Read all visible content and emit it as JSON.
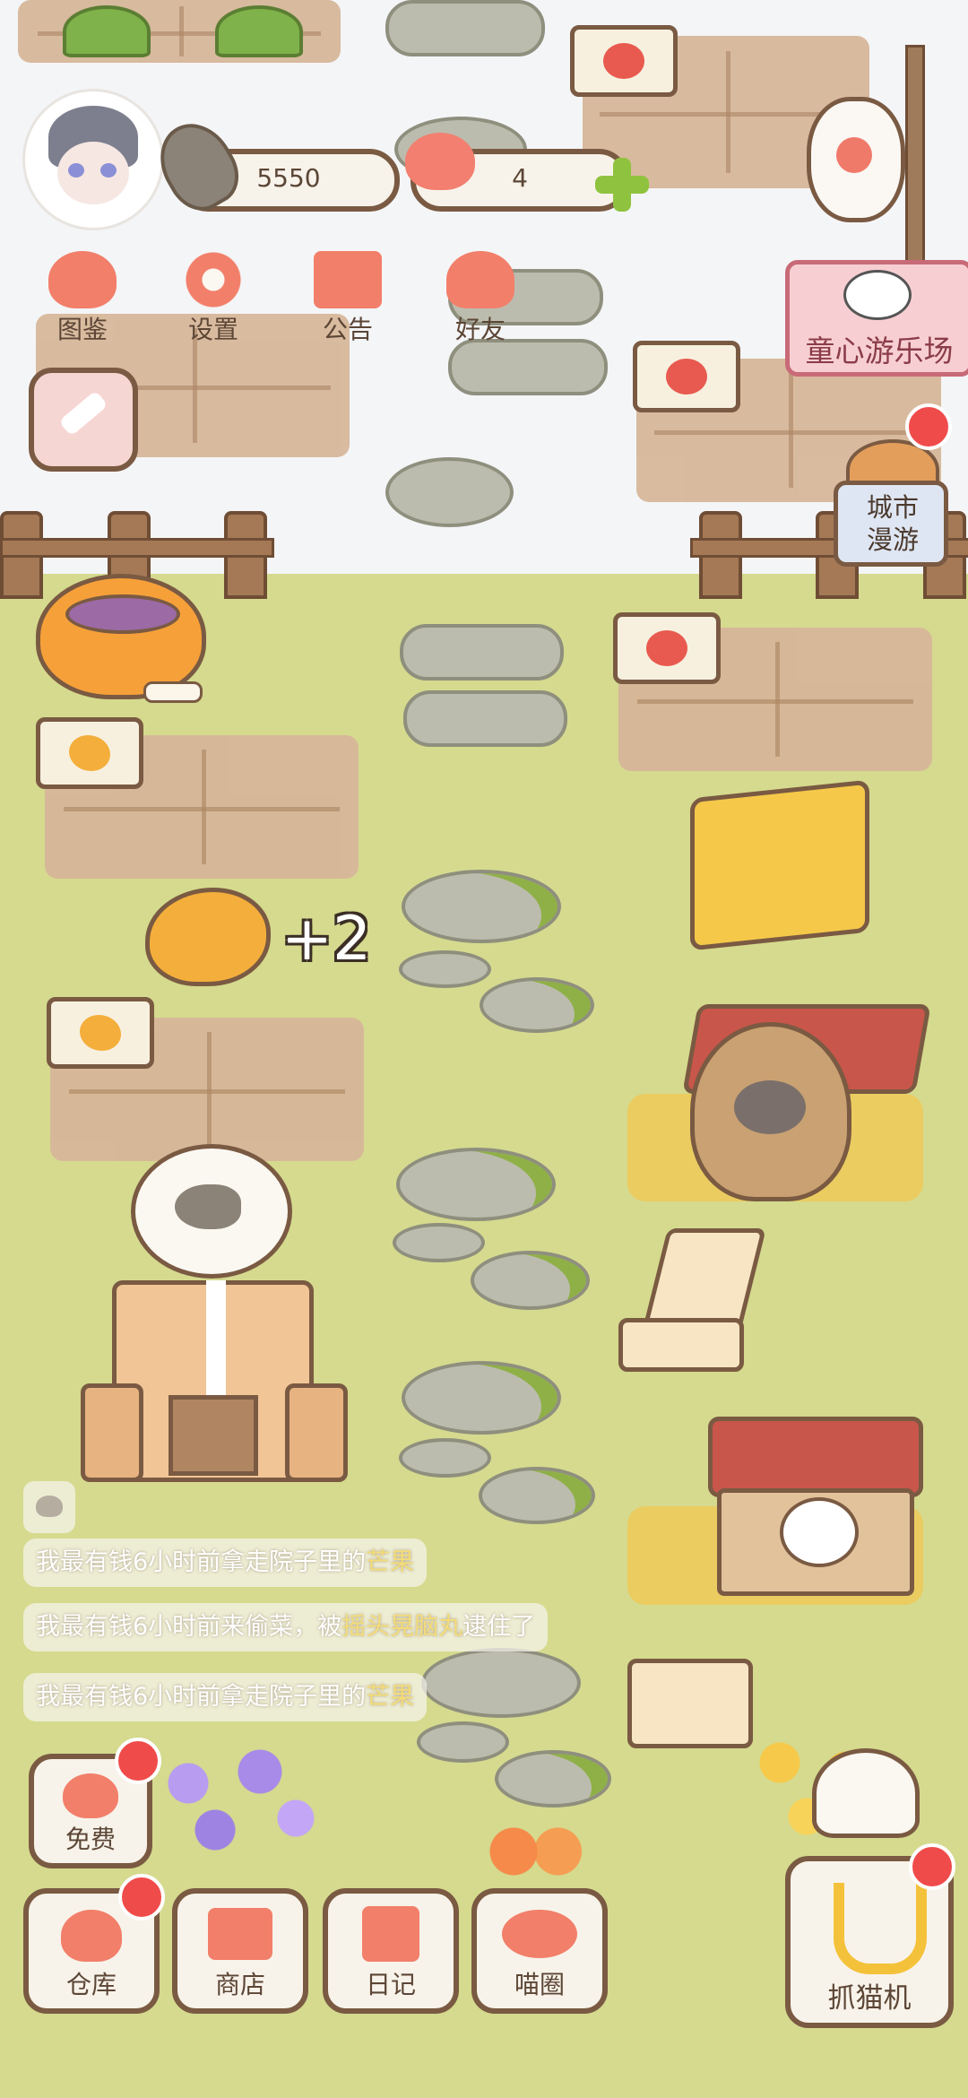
{
  "currency": {
    "fish": "5550",
    "hearts": "4"
  },
  "top_menu": [
    {
      "label": "图鉴",
      "icon": "cat-face-icon"
    },
    {
      "label": "设置",
      "icon": "gear-icon"
    },
    {
      "label": "公告",
      "icon": "gift-icon"
    },
    {
      "label": "好友",
      "icon": "friends-icon"
    }
  ],
  "amusement_park_sign": "童心游乐场",
  "city_tour": "城市漫游",
  "harvest_popup": "+2",
  "notices": [
    {
      "user": "我最有钱",
      "text": "6小时前拿走院子里的",
      "item": "芒果",
      "extra": ""
    },
    {
      "user": "我最有钱",
      "text": "6小时前来偷菜，被",
      "item": "摇头晃脑丸",
      "extra": "逮住了"
    },
    {
      "user": "我最有钱",
      "text": "6小时前拿走院子里的",
      "item": "芒果",
      "extra": ""
    }
  ],
  "bottom_menu": {
    "free": "免费",
    "warehouse": "仓库",
    "shop": "商店",
    "diary": "日记",
    "cat_circle": "喵圈",
    "claw_machine": "抓猫机"
  },
  "colors": {
    "accent": "#f07a5a",
    "badge": "#f04b4b",
    "outline": "#7a5a42",
    "grass": "#d5da8e"
  }
}
